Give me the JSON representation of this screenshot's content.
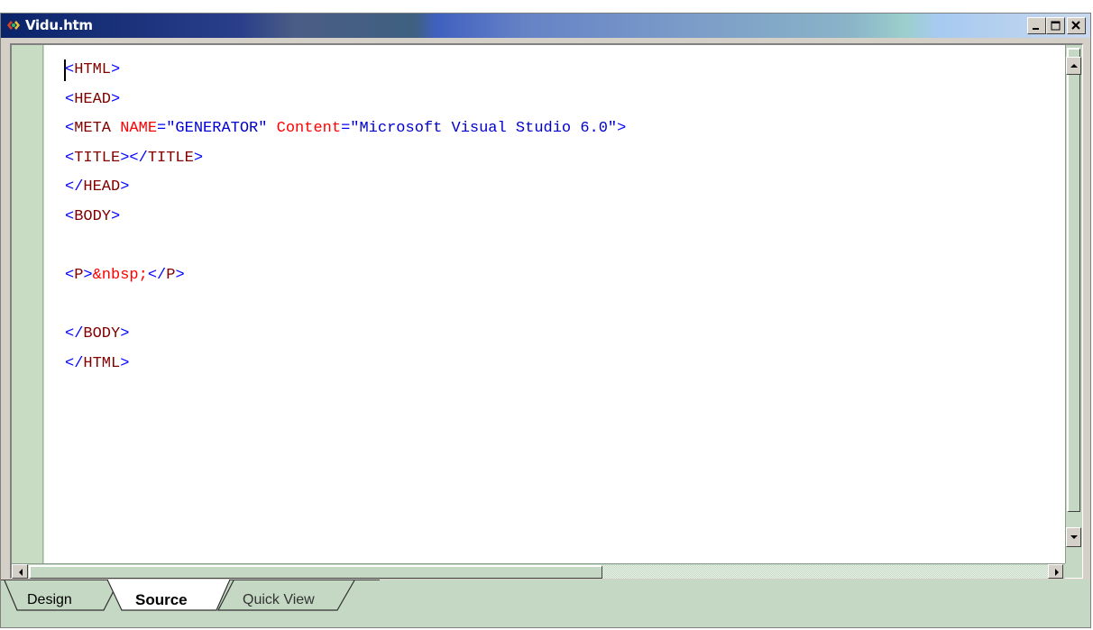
{
  "window": {
    "title": "Vidu.htm",
    "icon": "visual-interdev-icon"
  },
  "window_controls": {
    "minimize": "minimize-icon",
    "maximize": "maximize-icon",
    "close": "close-icon"
  },
  "editor": {
    "lines": [
      [
        {
          "t": "<",
          "c": "b"
        },
        {
          "t": "HTML",
          "c": "m"
        },
        {
          "t": ">",
          "c": "b"
        }
      ],
      [
        {
          "t": "<",
          "c": "b"
        },
        {
          "t": "HEAD",
          "c": "m"
        },
        {
          "t": ">",
          "c": "b"
        }
      ],
      [
        {
          "t": "<",
          "c": "b"
        },
        {
          "t": "META",
          "c": "m"
        },
        {
          "t": " ",
          "c": "m"
        },
        {
          "t": "NAME",
          "c": "r"
        },
        {
          "t": "=",
          "c": "b"
        },
        {
          "t": "\"GENERATOR\"",
          "c": "db"
        },
        {
          "t": " ",
          "c": "m"
        },
        {
          "t": "Content",
          "c": "r"
        },
        {
          "t": "=",
          "c": "b"
        },
        {
          "t": "\"Microsoft Visual Studio 6.0\"",
          "c": "db"
        },
        {
          "t": ">",
          "c": "b"
        }
      ],
      [
        {
          "t": "<",
          "c": "b"
        },
        {
          "t": "TITLE",
          "c": "m"
        },
        {
          "t": "></",
          "c": "b"
        },
        {
          "t": "TITLE",
          "c": "m"
        },
        {
          "t": ">",
          "c": "b"
        }
      ],
      [
        {
          "t": "</",
          "c": "b"
        },
        {
          "t": "HEAD",
          "c": "m"
        },
        {
          "t": ">",
          "c": "b"
        }
      ],
      [
        {
          "t": "<",
          "c": "b"
        },
        {
          "t": "BODY",
          "c": "m"
        },
        {
          "t": ">",
          "c": "b"
        }
      ],
      [],
      [
        {
          "t": "<",
          "c": "b"
        },
        {
          "t": "P",
          "c": "m"
        },
        {
          "t": ">",
          "c": "b"
        },
        {
          "t": "&nbsp;",
          "c": "r"
        },
        {
          "t": "</",
          "c": "b"
        },
        {
          "t": "P",
          "c": "m"
        },
        {
          "t": ">",
          "c": "b"
        }
      ],
      [],
      [
        {
          "t": "</",
          "c": "b"
        },
        {
          "t": "BODY",
          "c": "m"
        },
        {
          "t": ">",
          "c": "b"
        }
      ],
      [
        {
          "t": "</",
          "c": "b"
        },
        {
          "t": "HTML",
          "c": "m"
        },
        {
          "t": ">",
          "c": "b"
        }
      ]
    ]
  },
  "colors": {
    "tag_bracket": "#0000ff",
    "tag_name": "#800000",
    "attribute": "#ff0000",
    "attr_value": "#0000cc",
    "entity": "#ff0000"
  },
  "tabs": [
    {
      "label": "Design",
      "active": false
    },
    {
      "label": "Source",
      "active": true
    },
    {
      "label": "Quick View",
      "active": false
    }
  ],
  "scrollbars": {
    "up": "arrow-up-icon",
    "down": "arrow-down-icon",
    "left": "arrow-left-icon",
    "right": "arrow-right-icon"
  }
}
